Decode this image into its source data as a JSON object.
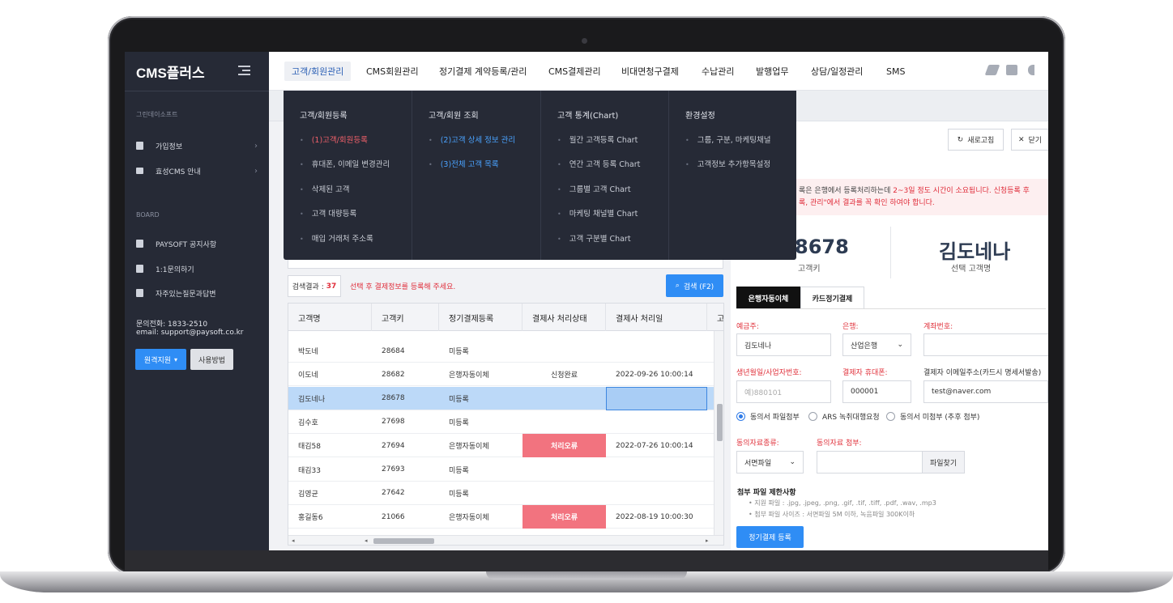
{
  "app": {
    "logo": "CMS플러스"
  },
  "sidebar": {
    "company": "그린데이소프트",
    "items": [
      {
        "label": "가입정보",
        "icon": "id-card-icon"
      },
      {
        "label": "효성CMS 안내",
        "icon": "card-icon"
      }
    ],
    "board_heading": "BOARD",
    "board_items": [
      {
        "label": "PAYSOFT 공지사항",
        "icon": "inbox-icon"
      },
      {
        "label": "1:1문의하기",
        "icon": "edit-icon"
      },
      {
        "label": "자주있는질문과답변",
        "icon": "copy-icon"
      }
    ],
    "phone": "문의전화: 1833-2510",
    "email": "email: support@paysoft.co.kr",
    "remote_button": "원격지원",
    "guide_button": "사용방법"
  },
  "topnav": {
    "items": [
      "고객/회원관리",
      "CMS회원관리",
      "정기결제 계약등록/관리",
      "CMS결제관리",
      "비대면청구결제",
      "수납관리",
      "발행업무",
      "상담/일정관리",
      "SMS"
    ],
    "active_index": 0
  },
  "mega_menu": {
    "columns": [
      {
        "title": "고객/회원등록",
        "items": [
          {
            "label": "(1)고객/회원등록",
            "style": "red"
          },
          {
            "label": "휴대폰, 이메일 변경관리",
            "style": ""
          },
          {
            "label": "삭제된 고객",
            "style": ""
          },
          {
            "label": "고객 대량등록",
            "style": ""
          },
          {
            "label": "매입 거래처 주소록",
            "style": ""
          }
        ]
      },
      {
        "title": "고객/회원 조회",
        "items": [
          {
            "label": "(2)고객 상세 정보 관리",
            "style": "blue"
          },
          {
            "label": "(3)전체 고객 목록",
            "style": "blue"
          }
        ]
      },
      {
        "title": "고객 통계(Chart)",
        "items": [
          {
            "label": "월간 고객등록 Chart",
            "style": ""
          },
          {
            "label": "연간 고객 등록 Chart",
            "style": ""
          },
          {
            "label": "그룹별 고객 Chart",
            "style": ""
          },
          {
            "label": "마케팅 채널별 Chart",
            "style": ""
          },
          {
            "label": "고객 구분별 Chart",
            "style": ""
          }
        ]
      },
      {
        "title": "환경설정",
        "items": [
          {
            "label": "그룹, 구분, 마케팅채널",
            "style": ""
          },
          {
            "label": "고객정보 추가항목설정",
            "style": ""
          }
        ]
      }
    ]
  },
  "search": {
    "result_label": "검색결과 :",
    "result_count": "37",
    "message": "선택 후 결제정보를 등록해 주세요.",
    "button": "검색 (F2)"
  },
  "grid": {
    "columns": [
      "고객명",
      "고객키",
      "정기결제등록",
      "결제사 처리상태",
      "결제사 처리일",
      "고"
    ],
    "rows": [
      {
        "name": "박도네",
        "key": "28684",
        "reg": "미등록",
        "status": "",
        "date": ""
      },
      {
        "name": "이도네",
        "key": "28682",
        "reg": "은행자동이체",
        "status": "신청완료",
        "date": "2022-09-26 10:00:14"
      },
      {
        "name": "김도네나",
        "key": "28678",
        "reg": "미등록",
        "status": "",
        "date": "",
        "selected": true
      },
      {
        "name": "김수호",
        "key": "27698",
        "reg": "미등록",
        "status": "",
        "date": ""
      },
      {
        "name": "태김58",
        "key": "27694",
        "reg": "은행자동이체",
        "status": "처리오류",
        "date": "2022-07-26 10:00:14",
        "error": true
      },
      {
        "name": "태김33",
        "key": "27693",
        "reg": "미등록",
        "status": "",
        "date": ""
      },
      {
        "name": "김영균",
        "key": "27642",
        "reg": "미등록",
        "status": "",
        "date": ""
      },
      {
        "name": "홍길동6",
        "key": "21066",
        "reg": "은행자동이체",
        "status": "처리오류",
        "date": "2022-08-19 10:00:30",
        "error": true
      }
    ]
  },
  "panel": {
    "refresh_button": "새로고침",
    "close_button": "닫기",
    "notice_line1_a": "록은 은행에서 등록처리하는데 ",
    "notice_line1_b": "2~3일 정도 시간이 소요됩니다. 신청등록 후",
    "notice_line2": "록, 관리\"에서 결과를 꼭 확인 하여야 합니다.",
    "customer_key_value": "8678",
    "customer_key_label": "고객키",
    "customer_name_value": "김도네나",
    "customer_name_label": "선택 고객명",
    "tabs": [
      "은행자동이체",
      "카드정기결제"
    ],
    "fields": {
      "depositor_label": "예금주:",
      "depositor_value": "김도네나",
      "bank_label": "은행:",
      "bank_value": "산업은행",
      "account_label": "계좌번호:",
      "account_value": "",
      "birth_label": "생년월일/사업자번호:",
      "birth_placeholder": "예)880101",
      "phone_label": "결제자 휴대폰:",
      "phone_value": "000001",
      "email_label": "결제자 이메일주소(카드시 명세서발송)",
      "email_value": "test@naver.com",
      "consent_type_label": "동의자료종류:",
      "consent_type_value": "서면파일",
      "consent_attach_label": "동의자료 첨부:",
      "find_file_button": "파일찾기"
    },
    "radios": [
      "동의서 파일첨부",
      "ARS 녹취대행요청",
      "동의서 미첨부 (추후 첨부)"
    ],
    "limit_title": "첨부 파일 제한사항",
    "limit_lines": [
      "• 지원 파일 : .jpg, .jpeg, .png, .gif, .tif, .tiff, .pdf, .wav, .mp3",
      "• 첨부 파일 사이즈 : 서면파일 5M 이하, 녹음파일 300K이하"
    ],
    "submit_button": "정기결제 등록"
  }
}
